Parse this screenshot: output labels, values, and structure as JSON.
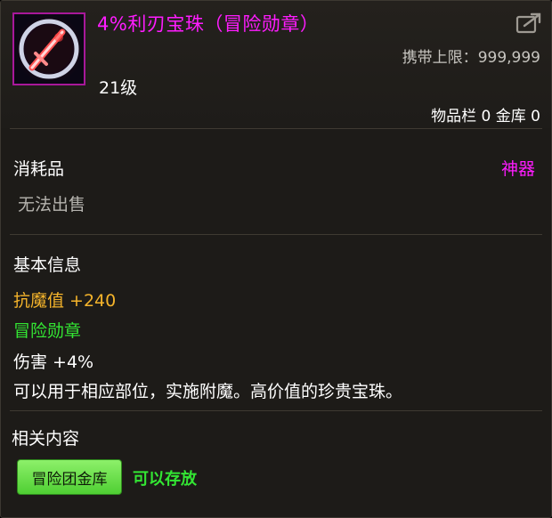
{
  "item": {
    "name": "4%利刃宝珠（冒险勋章）",
    "icon": "sword-orb-icon",
    "carry_limit_label": "携带上限：",
    "carry_limit_value": "999,999",
    "level": "21级",
    "storage_text": "物品栏 0 金库 0"
  },
  "category": {
    "type": "消耗品",
    "rarity": "神器",
    "sell_status": "无法出售"
  },
  "basic_info": {
    "title": "基本信息",
    "stat": "抗魔值 +240",
    "medal": "冒险勋章",
    "damage": "伤害 +4%",
    "description": "可以用于相应部位，实施附魔。高价值的珍贵宝珠。"
  },
  "related": {
    "title": "相关内容",
    "tag_button": "冒险团金库",
    "tag_note": "可以存放"
  },
  "colors": {
    "rarity_magenta": "#ff1cff",
    "stat_orange": "#f5b42b",
    "medal_green": "#33e633"
  }
}
